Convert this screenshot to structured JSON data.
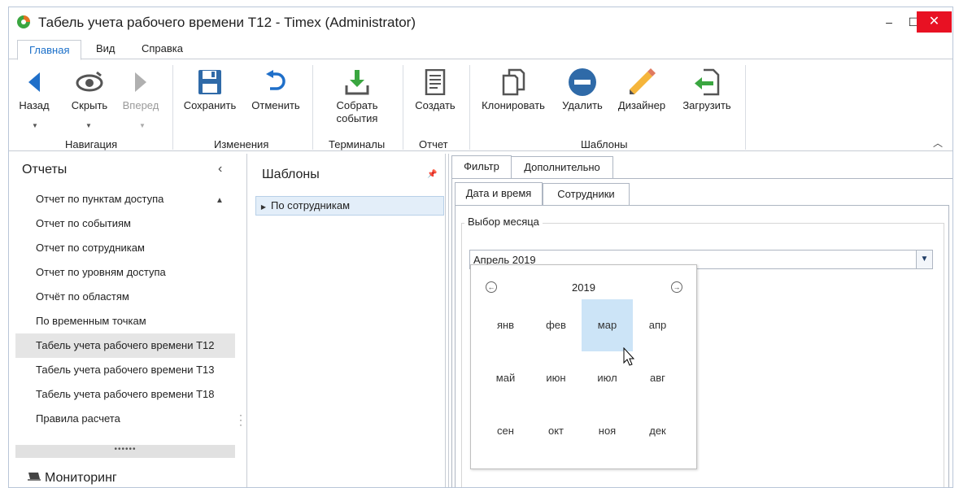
{
  "window": {
    "title": "Табель учета рабочего времени Т12 - Timex (Administrator)",
    "minimize_label": "‒",
    "maximize_label": "☐",
    "close_label": "✕"
  },
  "menu": {
    "tabs": [
      "Главная",
      "Вид",
      "Справка"
    ]
  },
  "ribbon": {
    "buttons": {
      "back": "Назад",
      "hide": "Скрыть",
      "forward": "Вперед",
      "save": "Сохранить",
      "cancel": "Отменить",
      "collect_line1": "Собрать",
      "collect_line2": "события",
      "create": "Создать",
      "clone": "Клонировать",
      "delete": "Удалить",
      "designer": "Дизайнер",
      "load": "Загрузить"
    },
    "groups": {
      "navigation": "Навигация",
      "changes": "Изменения",
      "terminals": "Терминалы",
      "report": "Отчет",
      "templates": "Шаблоны"
    },
    "collapse_icon": "chevron-up-icon"
  },
  "reports_panel": {
    "title": "Отчеты",
    "items": [
      "Отчет по пунктам доступа",
      "Отчет по событиям",
      "Отчет по сотрудникам",
      "Отчет по уровням доступа",
      "Отчёт по областям",
      "По временным точкам",
      "Табель учета рабочего времени Т12",
      "Табель учета рабочего времени Т13",
      "Табель учета рабочего времени Т18",
      "Правила расчета"
    ],
    "selected_index": 6,
    "splitter": "••••••",
    "monitoring": "Мониторинг"
  },
  "templates_panel": {
    "title": "Шаблоны",
    "pin_icon": "pin-icon",
    "row": "По сотрудникам"
  },
  "filter_panel": {
    "tabs": [
      "Фильтр",
      "Дополнительно"
    ],
    "subtabs": [
      "Дата и время",
      "Сотрудники"
    ],
    "group_label": "Выбор месяца",
    "combo_value": "Апрель 2019",
    "calendar": {
      "year": "2019",
      "months": [
        "янв",
        "фев",
        "мар",
        "апр",
        "май",
        "июн",
        "июл",
        "авг",
        "сен",
        "окт",
        "ноя",
        "дек"
      ],
      "hover_month": "мар"
    }
  },
  "colors": {
    "accent": "#1a6fc9",
    "close_red": "#e81123",
    "selection": "#cce4f7",
    "list_selected": "#e5e5e5"
  }
}
